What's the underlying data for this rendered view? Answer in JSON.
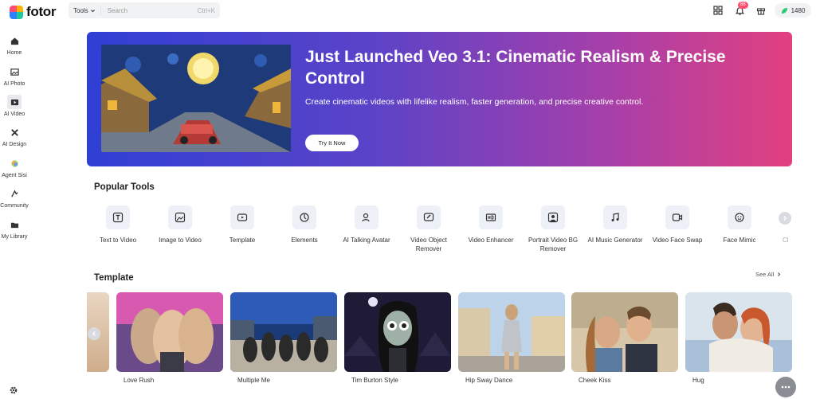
{
  "brand": {
    "name": "fotor"
  },
  "search": {
    "tools_label": "Tools",
    "placeholder": "Search",
    "shortcut": "Ctrl+K"
  },
  "header": {
    "notification_count": "86",
    "credits": "1480"
  },
  "sidebar": {
    "items": [
      {
        "label": "Home",
        "icon": "home-icon"
      },
      {
        "label": "AI Photo",
        "icon": "photo-icon"
      },
      {
        "label": "AI Video",
        "icon": "video-icon",
        "active": true
      },
      {
        "label": "AI Design",
        "icon": "design-icon"
      },
      {
        "label": "Agent Sisi",
        "icon": "agent-icon"
      },
      {
        "label": "Community",
        "icon": "community-icon"
      },
      {
        "label": "My Library",
        "icon": "folder-icon"
      }
    ]
  },
  "hero": {
    "title": "Just Launched Veo 3.1: Cinematic Realism & Precise Control",
    "subtitle": "Create cinematic videos with lifelike realism, faster generation, and precise creative control.",
    "button": "Try It Now"
  },
  "popular_tools": {
    "title": "Popular Tools",
    "items": [
      "Text to Video",
      "Image to Video",
      "Template",
      "Elements",
      "AI Talking Avatar",
      "Video Object Remover",
      "Video Enhancer",
      "Portrait Video BG Remover",
      "AI Music Generator",
      "Video Face Swap",
      "Face Mimic",
      "Cl"
    ]
  },
  "template": {
    "title": "Template",
    "see_all": "See All",
    "items": [
      "Love Rush",
      "Multiple Me",
      "Tim Burton Style",
      "Hip Sway Dance",
      "Cheek Kiss",
      "Hug"
    ]
  },
  "colors": {
    "hero_start": "#2f3fd4",
    "hero_end": "#e2407f",
    "tool_icon_bg": "#eef0f8"
  }
}
